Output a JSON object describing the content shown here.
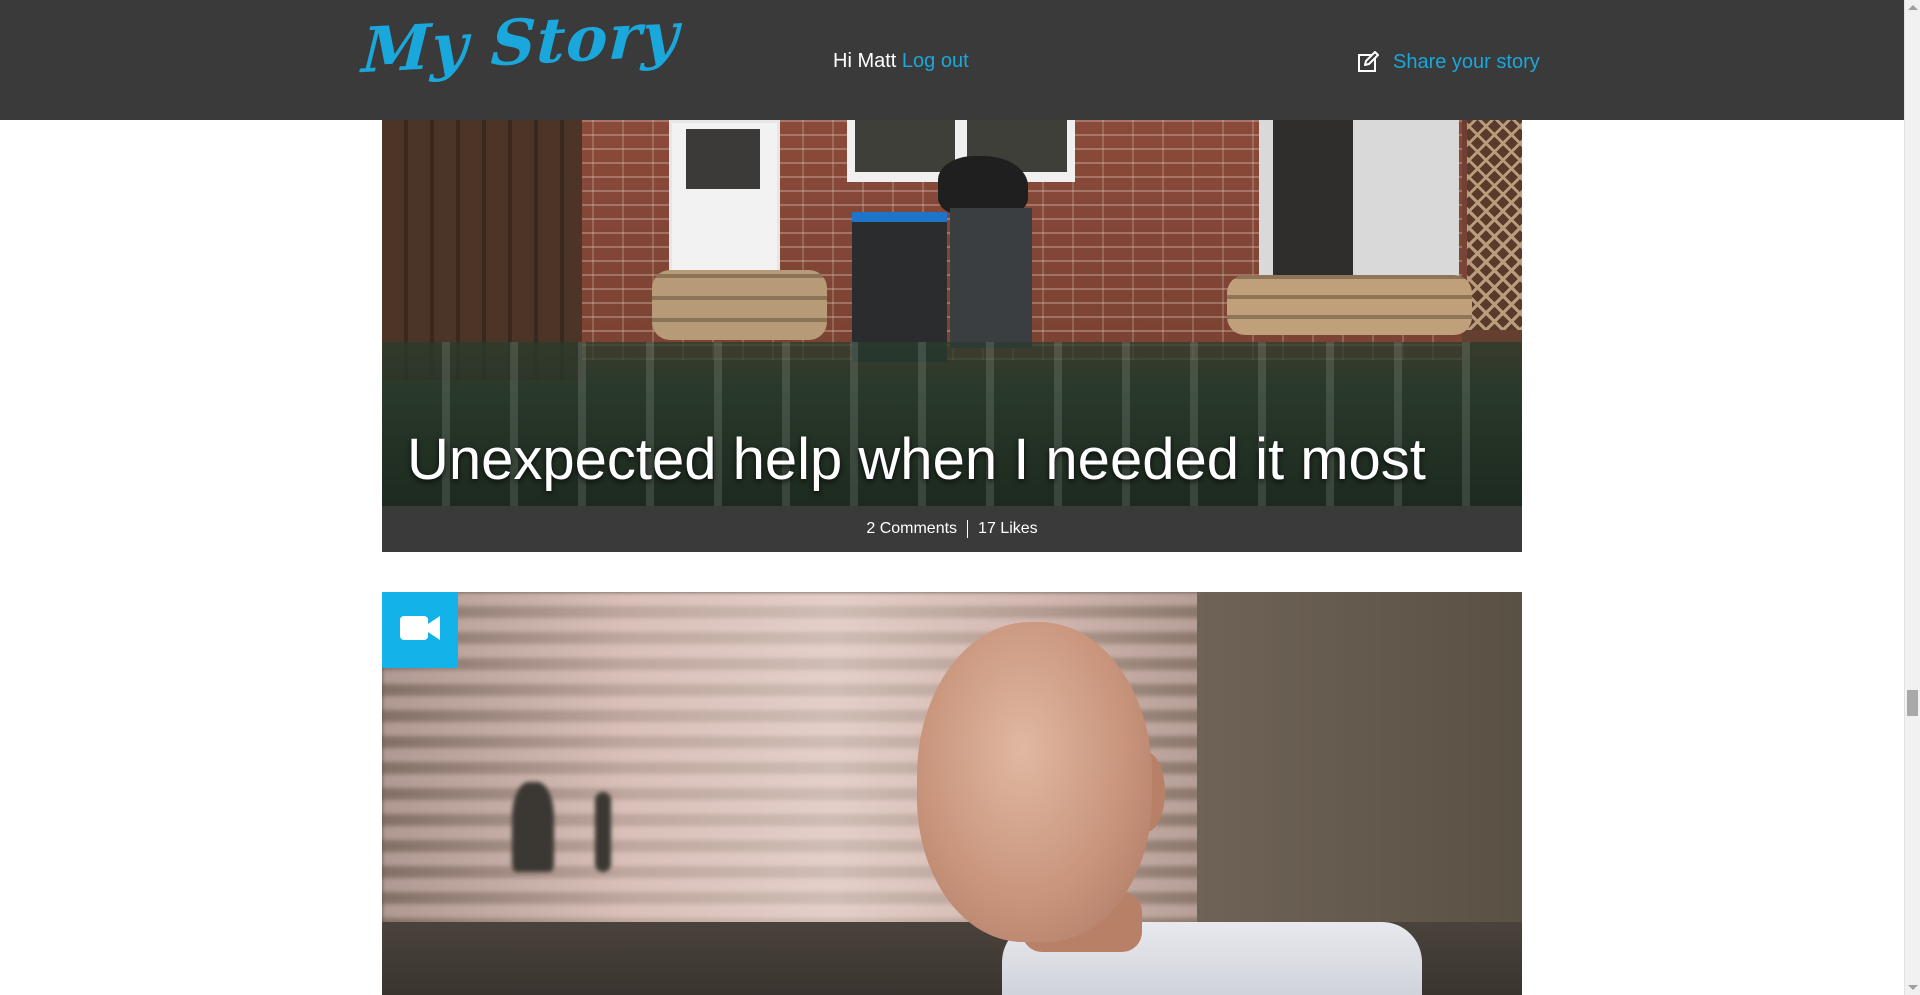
{
  "header": {
    "logo_text": "My Story",
    "greeting_prefix": "Hi Matt",
    "logout_label": "Log out",
    "share_label": "Share your story",
    "share_icon": "edit-icon",
    "accent_color": "#1aa7dc",
    "background_color": "#3a3a3a"
  },
  "stories": [
    {
      "title": "Unexpected help when I needed it most",
      "image": "flooded-garden-with-sandbags-and-bins",
      "comments_label": "2 Comments",
      "likes_label": "17 Likes"
    },
    {
      "title": "",
      "image": "portrait-of-man-indoors",
      "media_icon": "video-camera-icon",
      "badge_color": "#13b2e8"
    }
  ]
}
